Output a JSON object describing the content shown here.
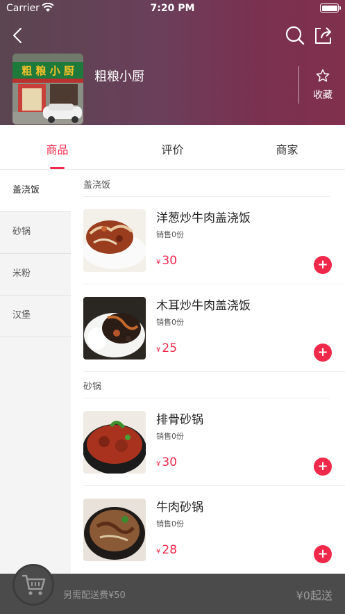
{
  "status_bar": {
    "carrier": "Carrier",
    "time": "7:20 PM"
  },
  "store": {
    "name": "粗粮小厨",
    "sign_text": "粗 粮 小 厨",
    "favorite_label": "收藏"
  },
  "tabs": [
    {
      "label": "商品",
      "active": true
    },
    {
      "label": "评价",
      "active": false
    },
    {
      "label": "商家",
      "active": false
    }
  ],
  "categories": [
    {
      "label": "盖浇饭",
      "active": true
    },
    {
      "label": "砂锅",
      "active": false
    },
    {
      "label": "米粉",
      "active": false
    },
    {
      "label": "汉堡",
      "active": false
    }
  ],
  "sections": [
    {
      "title": "盖浇饭",
      "items": [
        {
          "name": "洋葱炒牛肉盖浇饭",
          "sales": "销售0份",
          "currency": "¥",
          "price": "30"
        },
        {
          "name": "木耳炒牛肉盖浇饭",
          "sales": "销售0份",
          "currency": "¥",
          "price": "25"
        }
      ]
    },
    {
      "title": "砂锅",
      "items": [
        {
          "name": "排骨砂锅",
          "sales": "销售0份",
          "currency": "¥",
          "price": "30"
        },
        {
          "name": "牛肉砂锅",
          "sales": "销售0份",
          "currency": "¥",
          "price": "28"
        }
      ]
    }
  ],
  "cart": {
    "delivery_text": "另需配送费¥50",
    "min_order_text": "¥0起送"
  },
  "colors": {
    "accent": "#f0294a",
    "cart_bar": "#4b4b4b"
  }
}
